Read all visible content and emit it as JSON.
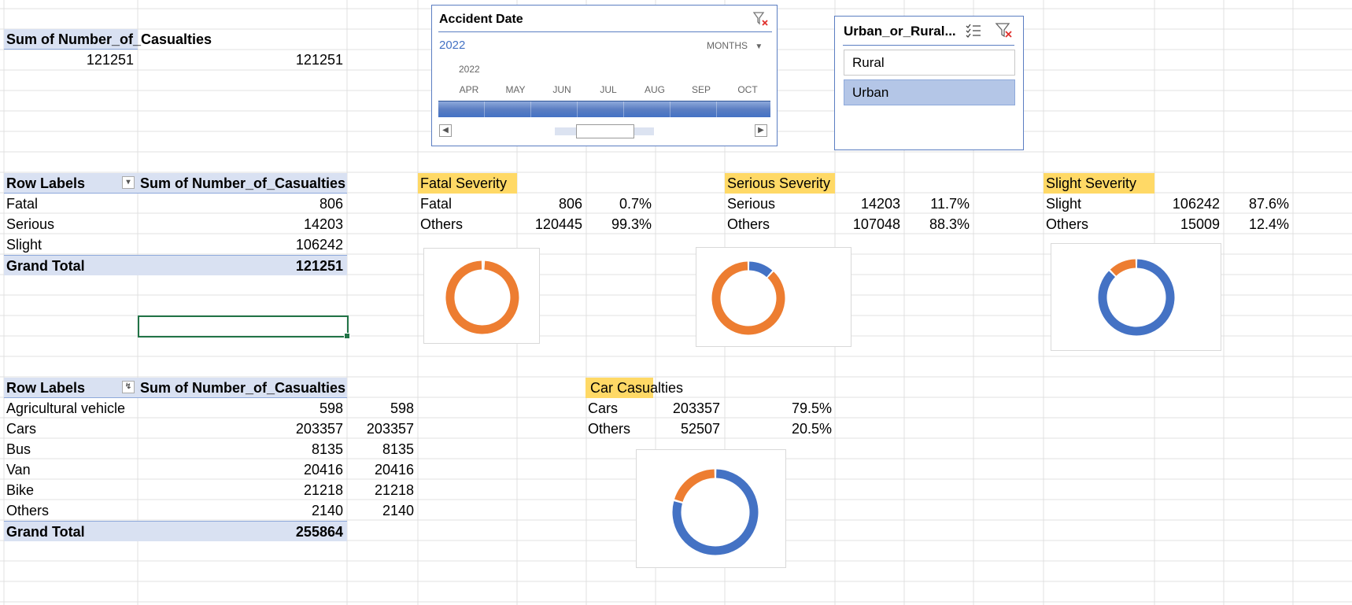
{
  "colors": {
    "accent": "#4472c4",
    "orange": "#ed7d31",
    "header_fill": "#d9e1f2",
    "highlight": "#ffd966",
    "selection": "#217346"
  },
  "sum_pivot": {
    "header": "Sum of Number_of_Casualties",
    "value_a": "121251",
    "value_b": "121251"
  },
  "severity_pivot": {
    "row_labels": "Row Labels",
    "sum_header": "Sum of Number_of_Casualties",
    "dropdown_icon": "dropdown-arrow-icon",
    "rows": [
      {
        "label": "Fatal",
        "value": "806"
      },
      {
        "label": "Serious",
        "value": "14203"
      },
      {
        "label": "Slight",
        "value": "106242"
      }
    ],
    "grand_total_label": "Grand Total",
    "grand_total_value": "121251"
  },
  "vehicle_pivot": {
    "row_labels": "Row Labels",
    "sum_header": "Sum of Number_of_Casualties",
    "filter_icon": "filter-dropdown-icon",
    "rows": [
      {
        "label": "Agricultural vehicle",
        "value": "598",
        "copy": "598"
      },
      {
        "label": "Cars",
        "value": "203357",
        "copy": "203357"
      },
      {
        "label": "Bus",
        "value": "8135",
        "copy": "8135"
      },
      {
        "label": "Van",
        "value": "20416",
        "copy": "20416"
      },
      {
        "label": "Bike",
        "value": "21218",
        "copy": "21218"
      },
      {
        "label": "Others",
        "value": "2140",
        "copy": "2140"
      }
    ],
    "grand_total_label": "Grand Total",
    "grand_total_value": "255864"
  },
  "fatal": {
    "title": "Fatal Severity",
    "rows": [
      {
        "label": "Fatal",
        "value": "806",
        "pct": "0.7%"
      },
      {
        "label": "Others",
        "value": "120445",
        "pct": "99.3%"
      }
    ]
  },
  "serious": {
    "title": "Serious Severity",
    "rows": [
      {
        "label": "Serious",
        "value": "14203",
        "pct": "11.7%"
      },
      {
        "label": "Others",
        "value": "107048",
        "pct": "88.3%"
      }
    ]
  },
  "slight": {
    "title": "Slight Severity",
    "rows": [
      {
        "label": "Slight",
        "value": "106242",
        "pct": "87.6%"
      },
      {
        "label": "Others",
        "value": "15009",
        "pct": "12.4%"
      }
    ]
  },
  "car": {
    "title": "Car Casualties",
    "rows": [
      {
        "label": "Cars",
        "value": "203357",
        "pct": "79.5%"
      },
      {
        "label": "Others",
        "value": "52507",
        "pct": "20.5%"
      }
    ]
  },
  "chart_data": [
    {
      "type": "pie",
      "categories": [
        "Fatal",
        "Others"
      ],
      "values": [
        0.7,
        99.3
      ],
      "colors": [
        "#4472c4",
        "#ed7d31"
      ]
    },
    {
      "type": "pie",
      "categories": [
        "Serious",
        "Others"
      ],
      "values": [
        11.7,
        88.3
      ],
      "colors": [
        "#4472c4",
        "#ed7d31"
      ]
    },
    {
      "type": "pie",
      "categories": [
        "Slight",
        "Others"
      ],
      "values": [
        87.6,
        12.4
      ],
      "colors": [
        "#4472c4",
        "#ed7d31"
      ]
    },
    {
      "type": "pie",
      "categories": [
        "Cars",
        "Others"
      ],
      "values": [
        79.5,
        20.5
      ],
      "colors": [
        "#4472c4",
        "#ed7d31"
      ]
    }
  ],
  "timeline": {
    "title": "Accident Date",
    "year": "2022",
    "level": "MONTHS",
    "small_year": "2022",
    "months": [
      "APR",
      "MAY",
      "JUN",
      "JUL",
      "AUG",
      "SEP",
      "OCT"
    ],
    "clear_filter_icon": "clear-filter-icon",
    "level_dropdown_icon": "dropdown-arrow-icon",
    "scroll_left_icon": "scroll-left-icon",
    "scroll_right_icon": "scroll-right-icon"
  },
  "slicer": {
    "title": "Urban_or_Rural...",
    "multiselect_icon": "multi-select-icon",
    "clear_filter_icon": "clear-filter-icon",
    "items": [
      {
        "label": "Rural",
        "selected": false
      },
      {
        "label": "Urban",
        "selected": true
      }
    ]
  }
}
